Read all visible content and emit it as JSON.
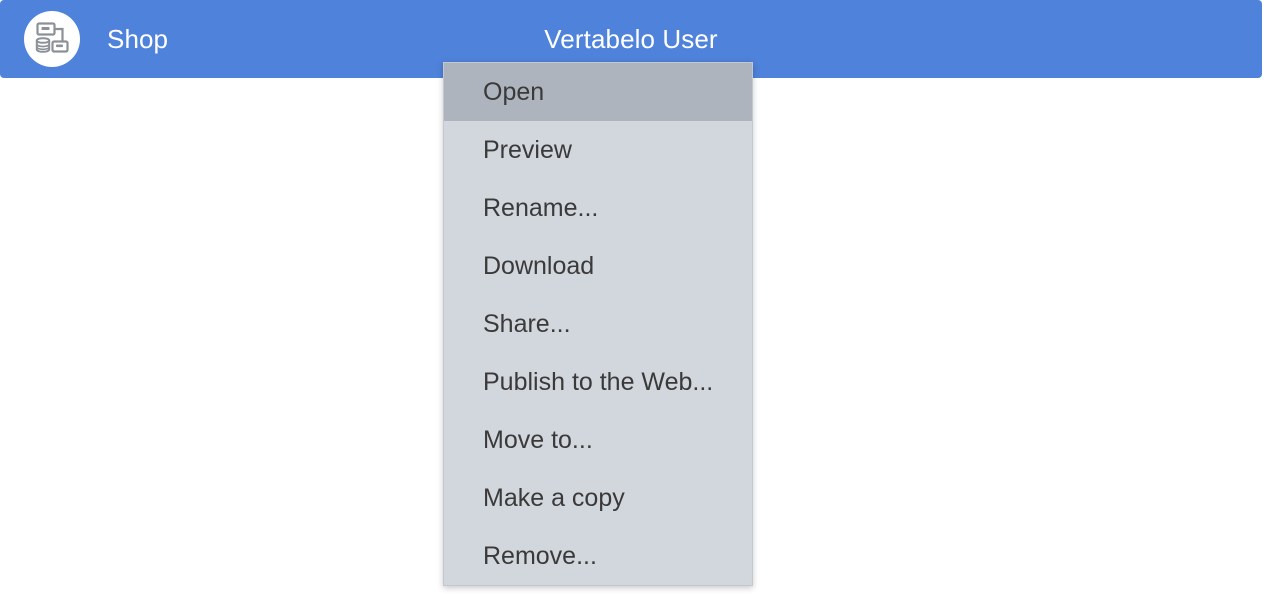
{
  "header": {
    "background_color": "#4f82db",
    "logo_icon": "vertabelo-erd-logo-icon",
    "brand_title": "Shop",
    "user_label": "Vertabelo User",
    "text_color": "#ffffff"
  },
  "context_menu": {
    "background_color": "#d2d6dd",
    "highlight_color": "#aeb4bd",
    "text_color": "#3a3a3a",
    "items": [
      {
        "label": "Open",
        "highlighted": true
      },
      {
        "label": "Preview",
        "highlighted": false
      },
      {
        "label": "Rename...",
        "highlighted": false
      },
      {
        "label": "Download",
        "highlighted": false
      },
      {
        "label": "Share...",
        "highlighted": false
      },
      {
        "label": "Publish to the Web...",
        "highlighted": false
      },
      {
        "label": "Move to...",
        "highlighted": false
      },
      {
        "label": "Make a copy",
        "highlighted": false
      },
      {
        "label": "Remove...",
        "highlighted": false
      }
    ]
  },
  "page": {
    "background_color": "#ffffff"
  }
}
